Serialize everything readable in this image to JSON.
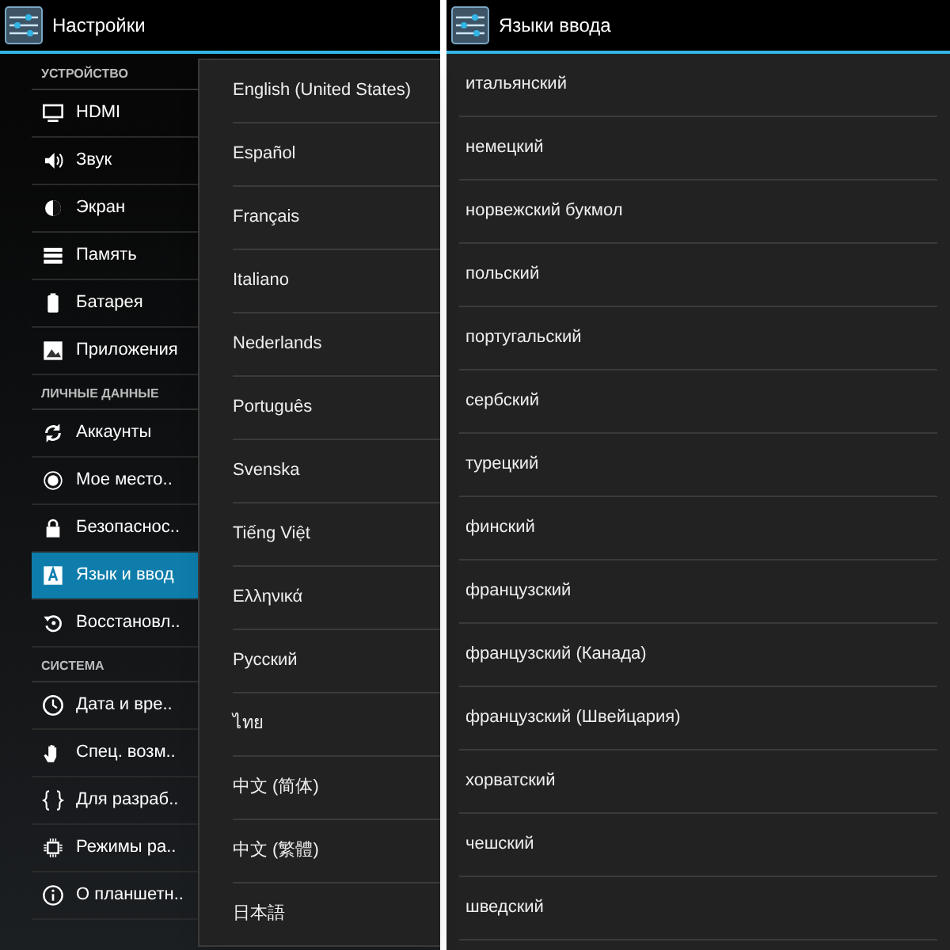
{
  "left": {
    "window": {
      "title": "Настройки"
    },
    "sidebar": {
      "sections": [
        {
          "header": "УСТРОЙСТВО",
          "items": [
            {
              "label": "HDMI",
              "selected": false
            },
            {
              "label": "Звук",
              "selected": false
            },
            {
              "label": "Экран",
              "selected": false
            },
            {
              "label": "Память",
              "selected": false
            },
            {
              "label": "Батарея",
              "selected": false
            },
            {
              "label": "Приложения",
              "selected": false
            }
          ]
        },
        {
          "header": "ЛИЧНЫЕ ДАННЫЕ",
          "items": [
            {
              "label": "Аккаунты",
              "selected": false
            },
            {
              "label": "Мое место..",
              "selected": false
            },
            {
              "label": "Безопаснос..",
              "selected": false
            },
            {
              "label": "Язык и ввод",
              "selected": true
            },
            {
              "label": "Восстановл..",
              "selected": false
            }
          ]
        },
        {
          "header": "СИСТЕМА",
          "items": [
            {
              "label": "Дата и вре..",
              "selected": false
            },
            {
              "label": "Спец. возм..",
              "selected": false
            },
            {
              "label": "Для разраб..",
              "selected": false
            },
            {
              "label": "Режимы ра..",
              "selected": false
            },
            {
              "label": "О планшетн..",
              "selected": false
            }
          ]
        }
      ]
    },
    "language_popup": {
      "items": [
        "English (United States)",
        "Español",
        "Français",
        "Italiano",
        "Nederlands",
        "Português",
        "Svenska",
        "Tiếng Việt",
        "Ελληνικά",
        "Русский",
        "ไทย",
        "中文 (简体)",
        "中文 (繁體)",
        "日本語"
      ]
    }
  },
  "right": {
    "window": {
      "title": "Языки ввода"
    },
    "list": {
      "items": [
        "итальянский",
        "немецкий",
        "норвежский букмол",
        "польский",
        "португальский",
        "сербский",
        "турецкий",
        "финский",
        "французский",
        "французский (Канада)",
        "французский (Швейцария)",
        "хорватский",
        "чешский",
        "шведский"
      ]
    }
  }
}
